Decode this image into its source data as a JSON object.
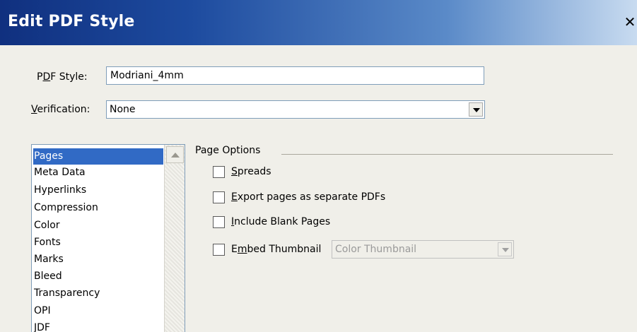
{
  "dialog": {
    "title": "Edit PDF Style",
    "close_label": "✕"
  },
  "pdf_style": {
    "label_pre": "P",
    "label_key": "D",
    "label_post": "F Style:",
    "value": "Modriani_4mm"
  },
  "verification": {
    "label_key": "V",
    "label_post": "erification:",
    "selected": "None"
  },
  "categories": {
    "items": [
      "Pages",
      "Meta Data",
      "Hyperlinks",
      "Compression",
      "Color",
      "Fonts",
      "Marks",
      "Bleed",
      "Transparency",
      "OPI",
      "JDF"
    ],
    "selected_index": 0
  },
  "page_options": {
    "title": "Page Options",
    "spreads": {
      "key": "S",
      "rest": "preads",
      "checked": false
    },
    "export_separate": {
      "key": "E",
      "rest": "xport pages as separate PDFs",
      "checked": false
    },
    "include_blank": {
      "key": "I",
      "rest": "nclude Blank Pages",
      "checked": false
    },
    "embed_thumbnail": {
      "pre": "E",
      "key": "m",
      "rest": "bed Thumbnail",
      "checked": false,
      "option": "Color Thumbnail"
    }
  }
}
